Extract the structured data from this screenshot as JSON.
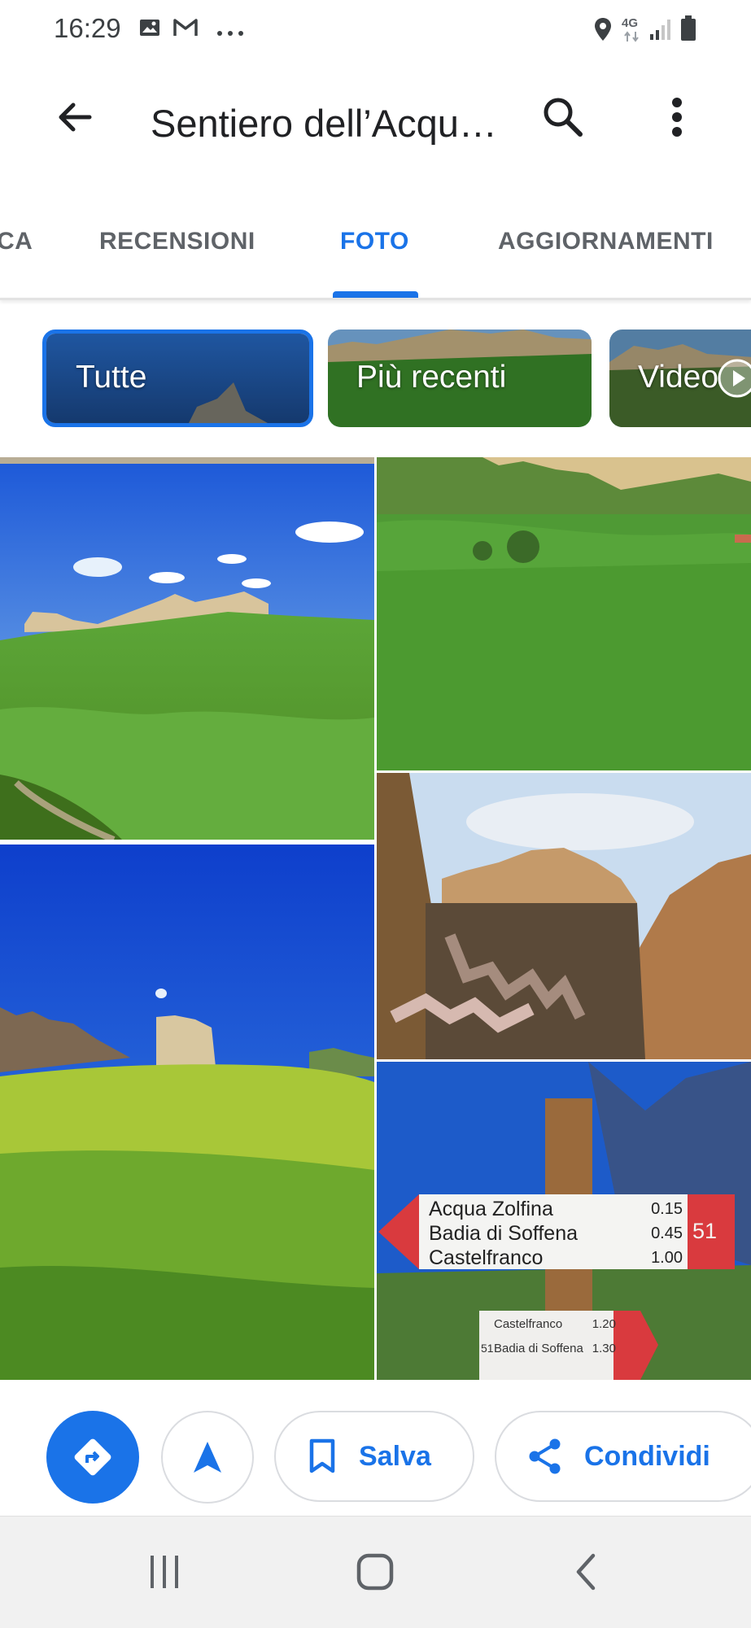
{
  "status_bar": {
    "time": "16:29",
    "network": "4G",
    "icons": [
      "image-icon",
      "gmail-icon",
      "more-dots-icon",
      "location-icon",
      "signal-icon",
      "battery-icon"
    ]
  },
  "app_bar": {
    "title": "Sentiero dell’Acqu…",
    "icons": [
      "back-arrow-icon",
      "search-icon",
      "overflow-menu-icon"
    ]
  },
  "tabs": {
    "items": [
      {
        "label": "CA"
      },
      {
        "label": "RECENSIONI"
      },
      {
        "label": "FOTO"
      },
      {
        "label": "AGGIORNAMENTI"
      }
    ],
    "active": "FOTO"
  },
  "filters": {
    "chips": [
      {
        "label": "Tutte",
        "selected": true
      },
      {
        "label": "Più recenti",
        "selected": false
      },
      {
        "label": "Video",
        "selected": false
      }
    ]
  },
  "photos": {
    "sign": {
      "rows": [
        {
          "place": "Acqua Zolfina",
          "value": "0.15"
        },
        {
          "place": "Badia di Soffena",
          "value": "0.45"
        },
        {
          "place": "Castelfranco",
          "value": "1.00"
        }
      ],
      "trail_number": "51",
      "lower_rows": [
        {
          "place": "Castelfranco",
          "value": "1.20"
        },
        {
          "place": "Badia di Soffena",
          "value": "1.30"
        }
      ],
      "lower_trail_number": "51"
    }
  },
  "actions": {
    "save_label": "Salva",
    "share_label": "Condividi",
    "icons": [
      "directions-icon",
      "navigation-arrow-icon",
      "bookmark-icon",
      "share-icon"
    ]
  },
  "colors": {
    "accent": "#1a73e8",
    "text_secondary": "#5f6368",
    "sign_red": "#d93a3e"
  }
}
